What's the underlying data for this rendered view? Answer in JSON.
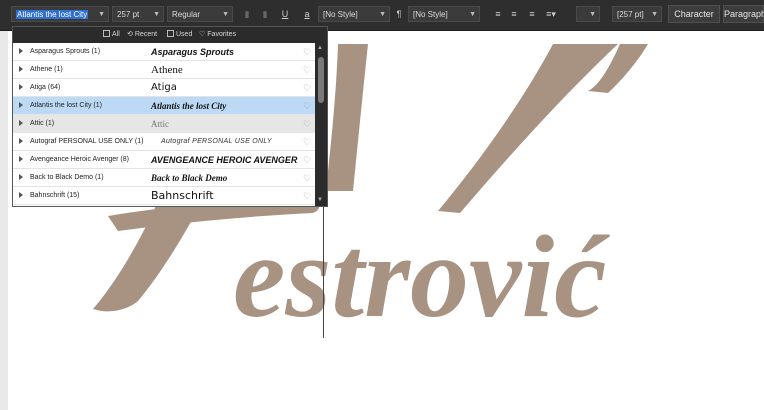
{
  "toolbar": {
    "font_name": "Atlantis the lost City",
    "font_size": "257 pt",
    "font_weight": "Regular",
    "char_style": "[No Style]",
    "para_style": "[No Style]",
    "leading": "[257 pt]",
    "character_label": "Character",
    "paragraph_label": "Paragraph",
    "underline_glyph": "U",
    "char_style_glyph": "a",
    "para_style_glyph": "¶"
  },
  "font_panel": {
    "filters": [
      {
        "label": "All",
        "icon": "all-icon"
      },
      {
        "label": "Recent",
        "icon": "recent-icon"
      },
      {
        "label": "Used",
        "icon": "used-icon"
      },
      {
        "label": "Favorites",
        "icon": "heart-icon"
      }
    ],
    "fonts": [
      {
        "name": "Asparagus Sprouts (1)",
        "preview": "Asparagus Sprouts",
        "state": ""
      },
      {
        "name": "Athene (1)",
        "preview": "Athene",
        "state": ""
      },
      {
        "name": "Atiga (64)",
        "preview": "Atiga",
        "state": ""
      },
      {
        "name": "Atlantis the lost City (1)",
        "preview": "Atlantis the lost City",
        "state": "selected"
      },
      {
        "name": "Attic (1)",
        "preview": "Attic",
        "state": "hover"
      },
      {
        "name": "Autograf PERSONAL USE ONLY (1)",
        "preview": "Autograf PERSONAL USE ONLY",
        "state": ""
      },
      {
        "name": "Avengeance Heroic Avenger (8)",
        "preview": "AVENGEANCE HEROIC AVENGER",
        "state": ""
      },
      {
        "name": "Back to Black Demo (1)",
        "preview": "Back to Black Demo",
        "state": ""
      },
      {
        "name": "Bahnschrift (15)",
        "preview": "Bahnschrift",
        "state": ""
      }
    ]
  },
  "canvas": {
    "artwork_text": "estrović",
    "art_color": "#a89282"
  }
}
